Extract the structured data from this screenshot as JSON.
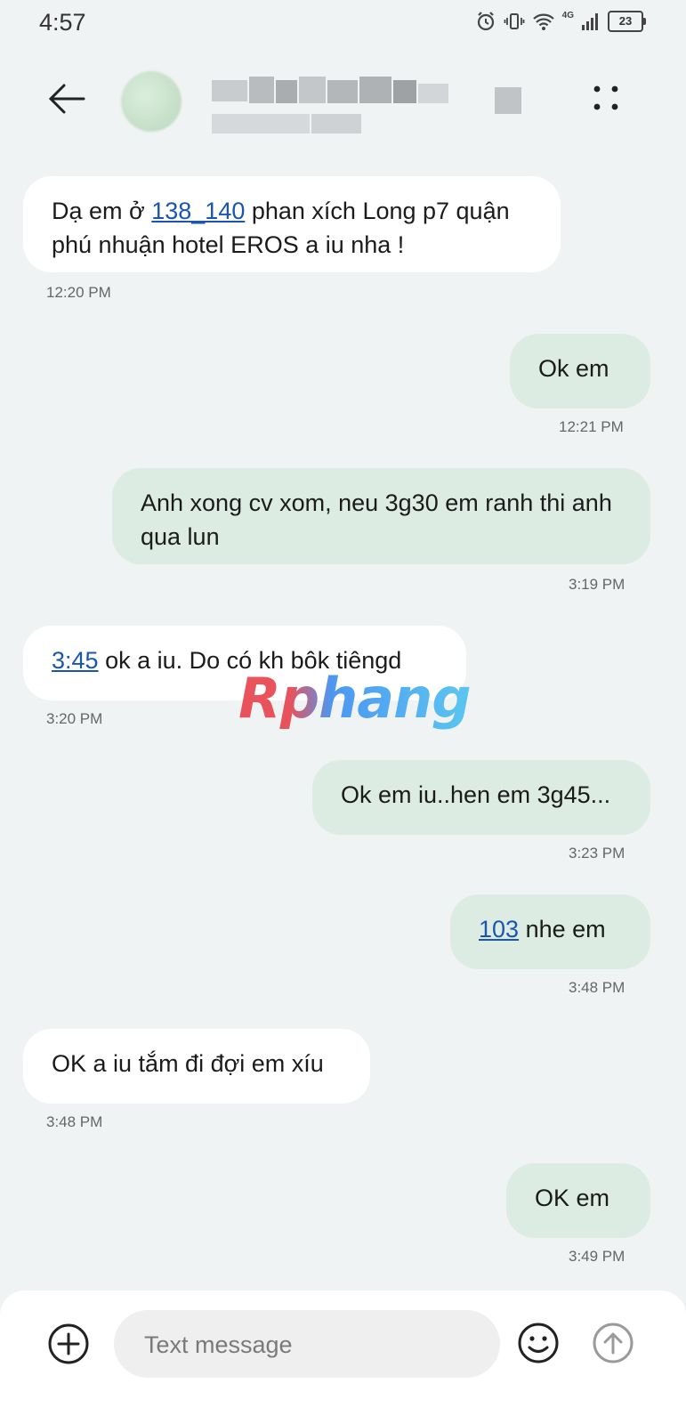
{
  "status_bar": {
    "time": "4:57",
    "network": "4G",
    "battery": "23"
  },
  "header": {
    "back_icon": "arrow-left-icon",
    "menu_icon": "more-vertical-icon"
  },
  "messages": [
    {
      "direction": "incoming",
      "parts": [
        {
          "text": "Dạ em ở "
        },
        {
          "text": "138_140",
          "link": true
        },
        {
          "text": " phan xích Long p7 quận phú nhuận hotel EROS a iu nha !"
        }
      ],
      "time": "12:20 PM"
    },
    {
      "direction": "outgoing",
      "parts": [
        {
          "text": "Ok em"
        }
      ],
      "time": "12:21 PM"
    },
    {
      "direction": "outgoing",
      "parts": [
        {
          "text": "Anh xong cv xom, neu 3g30 em ranh thi anh qua lun"
        }
      ],
      "time": "3:19 PM"
    },
    {
      "direction": "incoming",
      "parts": [
        {
          "text": "3:45",
          "link": true
        },
        {
          "text": " ok a iu. Do có kh bôk tiêngd"
        }
      ],
      "time": "3:20 PM"
    },
    {
      "direction": "outgoing",
      "parts": [
        {
          "text": "Ok em iu..hen em 3g45..."
        }
      ],
      "time": "3:23 PM"
    },
    {
      "direction": "outgoing",
      "parts": [
        {
          "text": "103",
          "link": true
        },
        {
          "text": " nhe em"
        }
      ],
      "time": "3:48 PM"
    },
    {
      "direction": "incoming",
      "parts": [
        {
          "text": "OK a iu tắm đi đợi em xíu"
        }
      ],
      "time": "3:48 PM"
    },
    {
      "direction": "outgoing",
      "parts": [
        {
          "text": "OK em"
        }
      ],
      "time": "3:49 PM"
    }
  ],
  "watermark": "Rphang",
  "composer": {
    "placeholder": "Text message",
    "value": ""
  },
  "colors": {
    "background": "#f0f3f3",
    "incoming_bubble": "#ffffff",
    "outgoing_bubble": "#dcece3",
    "link": "#1a56b0"
  }
}
